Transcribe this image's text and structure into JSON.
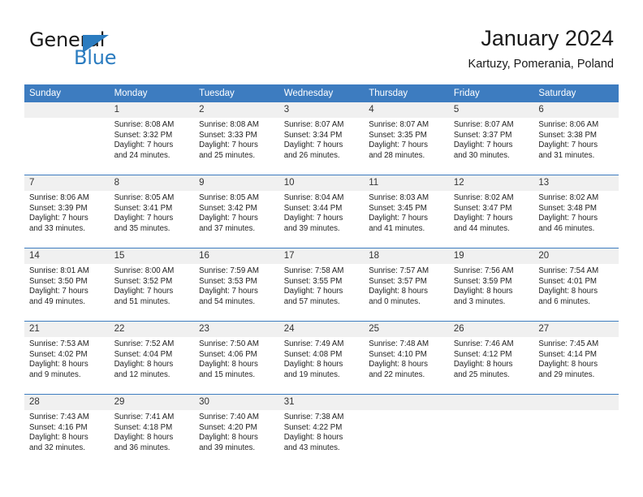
{
  "brand": {
    "name_part1": "General",
    "name_part2": "Blue",
    "logo_icon": "triangle-icon",
    "accent_color": "#2b7cc0"
  },
  "header": {
    "title": "January 2024",
    "location": "Kartuzy, Pomerania, Poland"
  },
  "calendar": {
    "header_bg": "#3d7cc0",
    "row_divider_color": "#3d7cc0",
    "daynum_bg": "#f0f0f0",
    "weekday_headers": [
      "Sunday",
      "Monday",
      "Tuesday",
      "Wednesday",
      "Thursday",
      "Friday",
      "Saturday"
    ],
    "weeks": [
      [
        {
          "day": "",
          "sunrise": "",
          "sunset": "",
          "daylight_line1": "",
          "daylight_line2": ""
        },
        {
          "day": "1",
          "sunrise": "Sunrise: 8:08 AM",
          "sunset": "Sunset: 3:32 PM",
          "daylight_line1": "Daylight: 7 hours",
          "daylight_line2": "and 24 minutes."
        },
        {
          "day": "2",
          "sunrise": "Sunrise: 8:08 AM",
          "sunset": "Sunset: 3:33 PM",
          "daylight_line1": "Daylight: 7 hours",
          "daylight_line2": "and 25 minutes."
        },
        {
          "day": "3",
          "sunrise": "Sunrise: 8:07 AM",
          "sunset": "Sunset: 3:34 PM",
          "daylight_line1": "Daylight: 7 hours",
          "daylight_line2": "and 26 minutes."
        },
        {
          "day": "4",
          "sunrise": "Sunrise: 8:07 AM",
          "sunset": "Sunset: 3:35 PM",
          "daylight_line1": "Daylight: 7 hours",
          "daylight_line2": "and 28 minutes."
        },
        {
          "day": "5",
          "sunrise": "Sunrise: 8:07 AM",
          "sunset": "Sunset: 3:37 PM",
          "daylight_line1": "Daylight: 7 hours",
          "daylight_line2": "and 30 minutes."
        },
        {
          "day": "6",
          "sunrise": "Sunrise: 8:06 AM",
          "sunset": "Sunset: 3:38 PM",
          "daylight_line1": "Daylight: 7 hours",
          "daylight_line2": "and 31 minutes."
        }
      ],
      [
        {
          "day": "7",
          "sunrise": "Sunrise: 8:06 AM",
          "sunset": "Sunset: 3:39 PM",
          "daylight_line1": "Daylight: 7 hours",
          "daylight_line2": "and 33 minutes."
        },
        {
          "day": "8",
          "sunrise": "Sunrise: 8:05 AM",
          "sunset": "Sunset: 3:41 PM",
          "daylight_line1": "Daylight: 7 hours",
          "daylight_line2": "and 35 minutes."
        },
        {
          "day": "9",
          "sunrise": "Sunrise: 8:05 AM",
          "sunset": "Sunset: 3:42 PM",
          "daylight_line1": "Daylight: 7 hours",
          "daylight_line2": "and 37 minutes."
        },
        {
          "day": "10",
          "sunrise": "Sunrise: 8:04 AM",
          "sunset": "Sunset: 3:44 PM",
          "daylight_line1": "Daylight: 7 hours",
          "daylight_line2": "and 39 minutes."
        },
        {
          "day": "11",
          "sunrise": "Sunrise: 8:03 AM",
          "sunset": "Sunset: 3:45 PM",
          "daylight_line1": "Daylight: 7 hours",
          "daylight_line2": "and 41 minutes."
        },
        {
          "day": "12",
          "sunrise": "Sunrise: 8:02 AM",
          "sunset": "Sunset: 3:47 PM",
          "daylight_line1": "Daylight: 7 hours",
          "daylight_line2": "and 44 minutes."
        },
        {
          "day": "13",
          "sunrise": "Sunrise: 8:02 AM",
          "sunset": "Sunset: 3:48 PM",
          "daylight_line1": "Daylight: 7 hours",
          "daylight_line2": "and 46 minutes."
        }
      ],
      [
        {
          "day": "14",
          "sunrise": "Sunrise: 8:01 AM",
          "sunset": "Sunset: 3:50 PM",
          "daylight_line1": "Daylight: 7 hours",
          "daylight_line2": "and 49 minutes."
        },
        {
          "day": "15",
          "sunrise": "Sunrise: 8:00 AM",
          "sunset": "Sunset: 3:52 PM",
          "daylight_line1": "Daylight: 7 hours",
          "daylight_line2": "and 51 minutes."
        },
        {
          "day": "16",
          "sunrise": "Sunrise: 7:59 AM",
          "sunset": "Sunset: 3:53 PM",
          "daylight_line1": "Daylight: 7 hours",
          "daylight_line2": "and 54 minutes."
        },
        {
          "day": "17",
          "sunrise": "Sunrise: 7:58 AM",
          "sunset": "Sunset: 3:55 PM",
          "daylight_line1": "Daylight: 7 hours",
          "daylight_line2": "and 57 minutes."
        },
        {
          "day": "18",
          "sunrise": "Sunrise: 7:57 AM",
          "sunset": "Sunset: 3:57 PM",
          "daylight_line1": "Daylight: 8 hours",
          "daylight_line2": "and 0 minutes."
        },
        {
          "day": "19",
          "sunrise": "Sunrise: 7:56 AM",
          "sunset": "Sunset: 3:59 PM",
          "daylight_line1": "Daylight: 8 hours",
          "daylight_line2": "and 3 minutes."
        },
        {
          "day": "20",
          "sunrise": "Sunrise: 7:54 AM",
          "sunset": "Sunset: 4:01 PM",
          "daylight_line1": "Daylight: 8 hours",
          "daylight_line2": "and 6 minutes."
        }
      ],
      [
        {
          "day": "21",
          "sunrise": "Sunrise: 7:53 AM",
          "sunset": "Sunset: 4:02 PM",
          "daylight_line1": "Daylight: 8 hours",
          "daylight_line2": "and 9 minutes."
        },
        {
          "day": "22",
          "sunrise": "Sunrise: 7:52 AM",
          "sunset": "Sunset: 4:04 PM",
          "daylight_line1": "Daylight: 8 hours",
          "daylight_line2": "and 12 minutes."
        },
        {
          "day": "23",
          "sunrise": "Sunrise: 7:50 AM",
          "sunset": "Sunset: 4:06 PM",
          "daylight_line1": "Daylight: 8 hours",
          "daylight_line2": "and 15 minutes."
        },
        {
          "day": "24",
          "sunrise": "Sunrise: 7:49 AM",
          "sunset": "Sunset: 4:08 PM",
          "daylight_line1": "Daylight: 8 hours",
          "daylight_line2": "and 19 minutes."
        },
        {
          "day": "25",
          "sunrise": "Sunrise: 7:48 AM",
          "sunset": "Sunset: 4:10 PM",
          "daylight_line1": "Daylight: 8 hours",
          "daylight_line2": "and 22 minutes."
        },
        {
          "day": "26",
          "sunrise": "Sunrise: 7:46 AM",
          "sunset": "Sunset: 4:12 PM",
          "daylight_line1": "Daylight: 8 hours",
          "daylight_line2": "and 25 minutes."
        },
        {
          "day": "27",
          "sunrise": "Sunrise: 7:45 AM",
          "sunset": "Sunset: 4:14 PM",
          "daylight_line1": "Daylight: 8 hours",
          "daylight_line2": "and 29 minutes."
        }
      ],
      [
        {
          "day": "28",
          "sunrise": "Sunrise: 7:43 AM",
          "sunset": "Sunset: 4:16 PM",
          "daylight_line1": "Daylight: 8 hours",
          "daylight_line2": "and 32 minutes."
        },
        {
          "day": "29",
          "sunrise": "Sunrise: 7:41 AM",
          "sunset": "Sunset: 4:18 PM",
          "daylight_line1": "Daylight: 8 hours",
          "daylight_line2": "and 36 minutes."
        },
        {
          "day": "30",
          "sunrise": "Sunrise: 7:40 AM",
          "sunset": "Sunset: 4:20 PM",
          "daylight_line1": "Daylight: 8 hours",
          "daylight_line2": "and 39 minutes."
        },
        {
          "day": "31",
          "sunrise": "Sunrise: 7:38 AM",
          "sunset": "Sunset: 4:22 PM",
          "daylight_line1": "Daylight: 8 hours",
          "daylight_line2": "and 43 minutes."
        },
        {
          "day": "",
          "sunrise": "",
          "sunset": "",
          "daylight_line1": "",
          "daylight_line2": ""
        },
        {
          "day": "",
          "sunrise": "",
          "sunset": "",
          "daylight_line1": "",
          "daylight_line2": ""
        },
        {
          "day": "",
          "sunrise": "",
          "sunset": "",
          "daylight_line1": "",
          "daylight_line2": ""
        }
      ]
    ]
  }
}
